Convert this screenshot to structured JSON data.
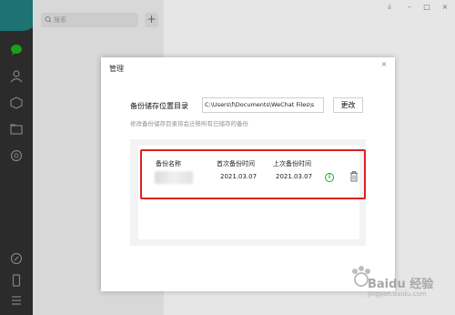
{
  "nav": {
    "icons": [
      "chat-icon",
      "contacts-icon",
      "favorites-icon",
      "folder-icon",
      "moments-icon",
      "mini-program-icon",
      "phone-icon",
      "menu-icon"
    ]
  },
  "search": {
    "placeholder": "搜索",
    "add_label": "+"
  },
  "window_controls": {
    "pin": "⫰",
    "minimize": "–",
    "maximize": "□",
    "close": "×"
  },
  "dialog": {
    "title": "管理",
    "close_label": "×",
    "storage_label": "备份储存位置目录",
    "storage_path": "C:\\Users\\f\\Documents\\WeChat Files\\s",
    "change_button": "更改",
    "hint": "修改备份储存目录将会迁移所有已储存的备份",
    "table": {
      "headers": [
        "备份名称",
        "首次备份时间",
        "上次备份时间"
      ],
      "rows": [
        {
          "name": "",
          "first_backup": "2021.03.07",
          "last_backup": "2021.03.07"
        }
      ]
    }
  },
  "colors": {
    "accent_green": "#1aad19",
    "highlight_red": "#dc2020",
    "sidebar": "#2e2e2e"
  },
  "watermark": {
    "text": "Baidu 经验",
    "url": "jingyan.baidu.com"
  }
}
